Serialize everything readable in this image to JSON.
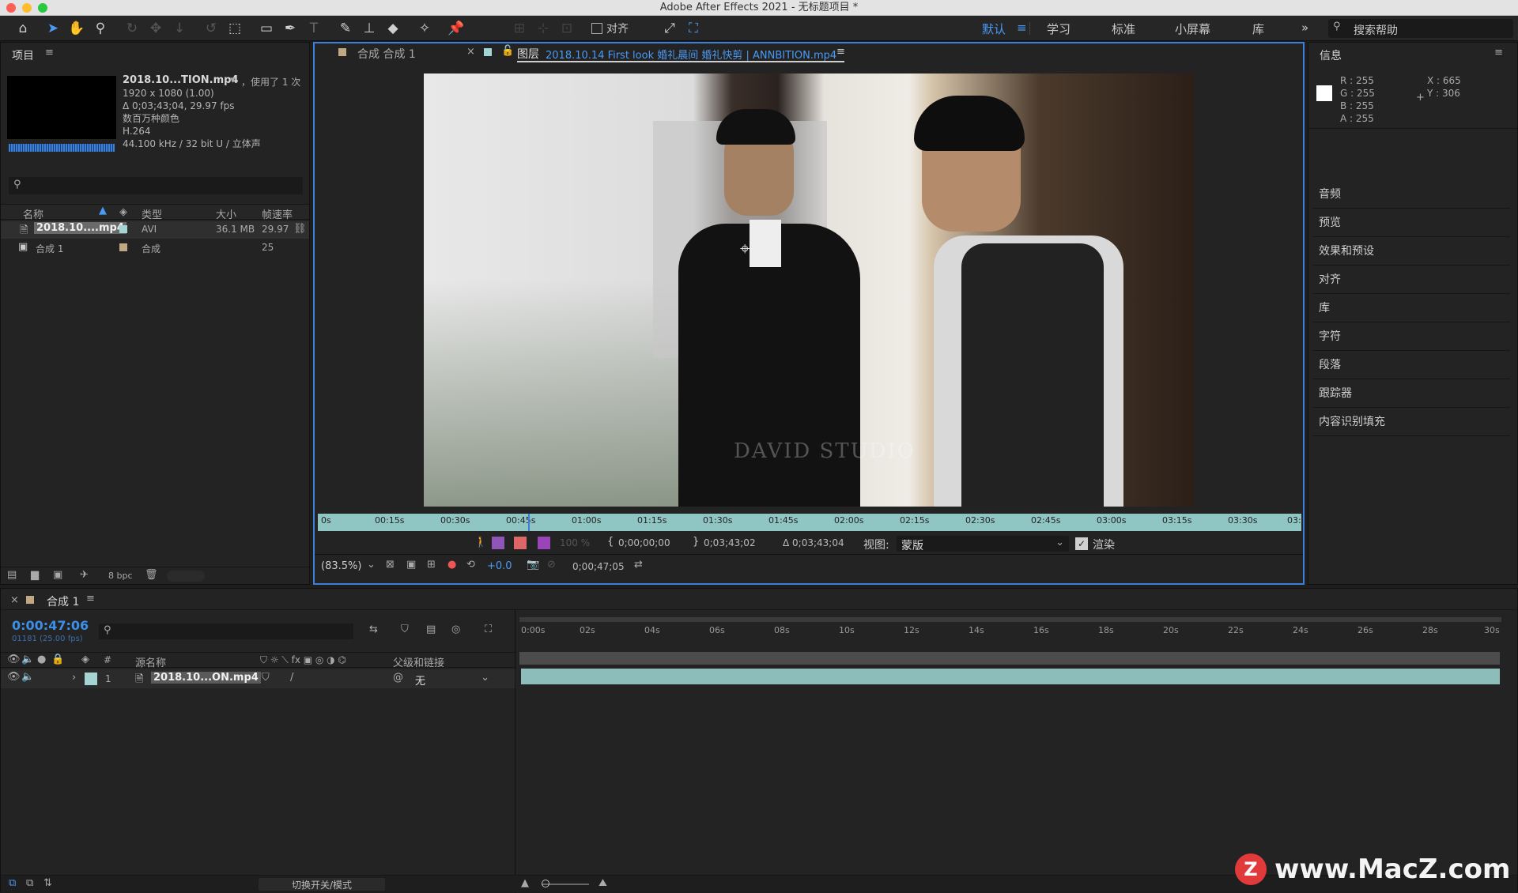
{
  "window": {
    "title": "Adobe After Effects 2021 - 无标题项目 *"
  },
  "toolbar": {
    "align_label": "对齐",
    "workspaces": [
      "默认",
      "学习",
      "标准",
      "小屏幕",
      "库"
    ],
    "active_workspace": "默认",
    "search_placeholder": "搜索帮助"
  },
  "project": {
    "title": "项目",
    "file_name": "2018.10...TION.mp4",
    "used": "，使用了 1 次",
    "lines": [
      "1920 x 1080 (1.00)",
      "Δ 0;03;43;04, 29.97 fps",
      "数百万种颜色",
      "H.264",
      "44.100 kHz / 32 bit U / 立体声"
    ],
    "columns": {
      "name": "名称",
      "type": "类型",
      "size": "大小",
      "fps": "帧速率"
    },
    "items": [
      {
        "name": "2018.10....mp4",
        "type": "AVI",
        "size": "36.1 MB",
        "fps": "29.97"
      },
      {
        "name": "合成 1",
        "type": "合成",
        "size": "",
        "fps": "25"
      }
    ],
    "bpc": "8 bpc"
  },
  "viewer": {
    "tab_comp": "合成 合成 1",
    "tab_layer_prefix": "图层",
    "tab_layer_name": "2018.10.14 First look 婚礼晨间 婚礼快剪 | ANNBITION.mp4",
    "watermark": "DAVID STUDIO",
    "ruler_labels": [
      "0s",
      "00:15s",
      "00:30s",
      "00:45s",
      "01:00s",
      "01:15s",
      "01:30s",
      "01:45s",
      "02:00s",
      "02:15s",
      "02:30s",
      "02:45s",
      "03:00s",
      "03:15s",
      "03:30s",
      "03:"
    ],
    "opacity": "100 %",
    "in_point": "0;00;00;00",
    "out_point": "0;03;43;02",
    "duration": "Δ 0;03;43;04",
    "view_label": "视图:",
    "view_value": "蒙版",
    "render_label": "渲染",
    "zoom": "(83.5%)",
    "exposure": "+0.0",
    "timecode": "0;00;47;05"
  },
  "info": {
    "title": "信息",
    "r": "R :  255",
    "g": "G :  255",
    "b": "B :  255",
    "a": "A :  255",
    "x": "X : 665",
    "y": "Y : 306",
    "panels": [
      "音频",
      "预览",
      "效果和预设",
      "对齐",
      "库",
      "字符",
      "段落",
      "跟踪器",
      "内容识别填充"
    ]
  },
  "timeline": {
    "tab": "合成 1",
    "timecode": "0:00:47:06",
    "frame_info": "01181 (25.00 fps)",
    "col_source": "源名称",
    "col_parent": "父级和链接",
    "layer_index": "1",
    "layer_name": "2018.10...ON.mp4",
    "parent_value": "无",
    "ruler_labels": [
      "0:00s",
      "02s",
      "04s",
      "06s",
      "08s",
      "10s",
      "12s",
      "14s",
      "16s",
      "18s",
      "20s",
      "22s",
      "24s",
      "26s",
      "28s",
      "30s"
    ],
    "toggle_label": "切换开关/模式"
  },
  "watermark_site": "www.MacZ.com"
}
